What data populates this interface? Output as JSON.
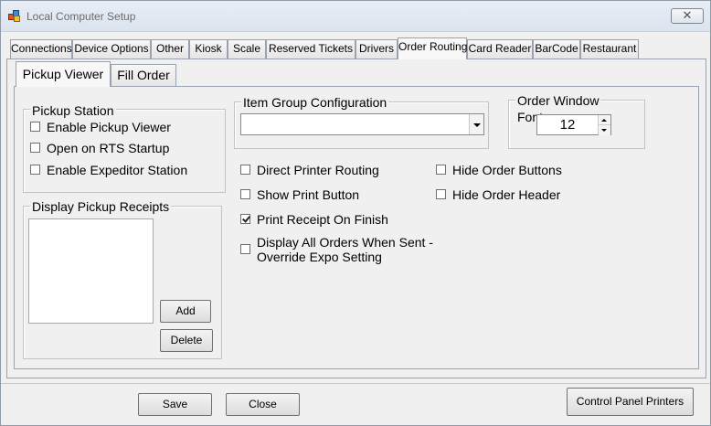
{
  "window": {
    "title": "Local Computer Setup",
    "close_glyph": "✕"
  },
  "tabs": [
    {
      "label": "Connections"
    },
    {
      "label": "Device Options"
    },
    {
      "label": "Other"
    },
    {
      "label": "Kiosk"
    },
    {
      "label": "Scale"
    },
    {
      "label": "Reserved Tickets"
    },
    {
      "label": "Drivers"
    },
    {
      "label": "Order Routing",
      "active": true
    },
    {
      "label": "Card Reader"
    },
    {
      "label": "BarCode"
    },
    {
      "label": "Restaurant"
    }
  ],
  "subtabs": [
    {
      "label": "Pickup Viewer",
      "active": true
    },
    {
      "label": "Fill Order"
    }
  ],
  "pickup_station": {
    "title": "Pickup Station",
    "options": [
      {
        "label": "Enable Pickup Viewer",
        "checked": false
      },
      {
        "label": "Open on RTS Startup",
        "checked": false
      },
      {
        "label": "Enable Expeditor Station",
        "checked": false
      }
    ]
  },
  "display_pickup_receipts": {
    "title": "Display Pickup Receipts",
    "add_label": "Add",
    "delete_label": "Delete"
  },
  "item_group": {
    "title": "Item Group Configuration",
    "value": ""
  },
  "order_window": {
    "title": "Order Window",
    "font_label": "Font",
    "font_value": "12"
  },
  "options": [
    {
      "label": "Direct Printer Routing",
      "checked": false
    },
    {
      "label": "Show Print Button",
      "checked": false
    },
    {
      "label": "Print Receipt On Finish",
      "checked": true
    },
    {
      "label": "Display All Orders When Sent -",
      "label2": "Override Expo Setting",
      "checked": false
    },
    {
      "label": "Hide Order Buttons",
      "checked": false
    },
    {
      "label": "Hide Order Header",
      "checked": false
    }
  ],
  "footer": {
    "save_label": "Save",
    "close_label": "Close",
    "control_panel_label": "Control Panel Printers"
  },
  "icons": {
    "app": "app-icon",
    "close": "close-icon",
    "dropdown": "chevron-down-icon",
    "spin_up": "spin-up-icon",
    "spin_down": "spin-down-icon"
  }
}
